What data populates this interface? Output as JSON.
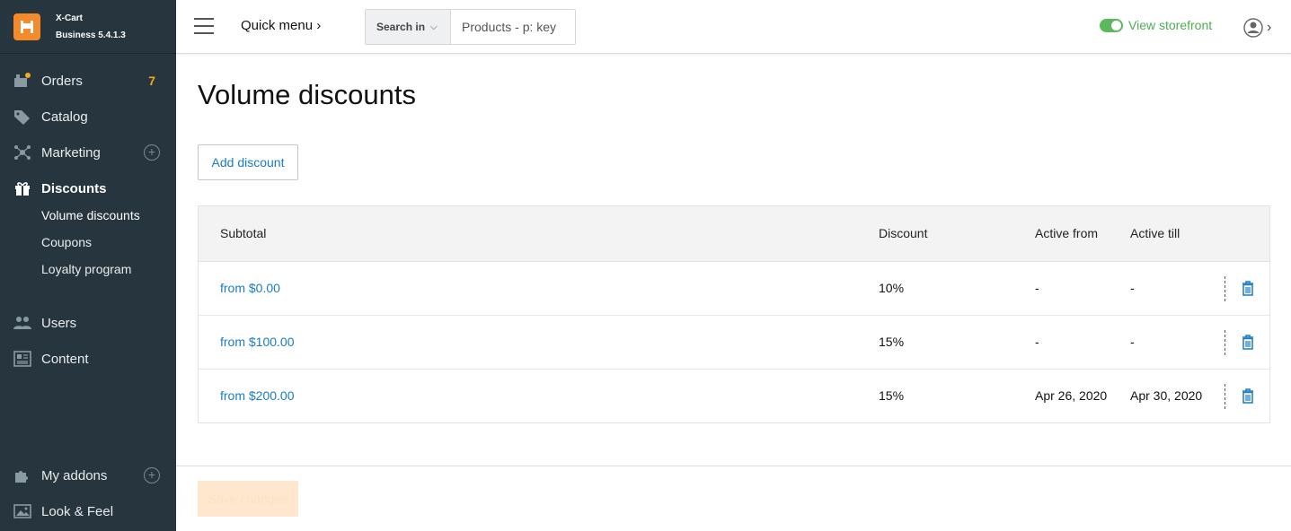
{
  "brand": {
    "name": "X-Cart",
    "edition": "Business 5.4.1.3",
    "accent": "#f48a2a"
  },
  "sidebar": {
    "items": [
      {
        "label": "Orders",
        "badge": "7",
        "icon": "orders-icon"
      },
      {
        "label": "Catalog",
        "icon": "tag-icon"
      },
      {
        "label": "Marketing",
        "icon": "marketing-icon"
      },
      {
        "label": "Discounts",
        "icon": "gift-icon"
      },
      {
        "label": "Users",
        "icon": "users-icon"
      },
      {
        "label": "Content",
        "icon": "content-icon"
      },
      {
        "label": "My addons",
        "icon": "puzzle-icon"
      },
      {
        "label": "Look & Feel",
        "icon": "image-icon"
      }
    ],
    "discounts_sub": [
      "Volume discounts",
      "Coupons",
      "Loyalty program"
    ]
  },
  "header": {
    "quick_menu": "Quick menu",
    "search_in_label": "Search in",
    "search_placeholder": "Products - p: key",
    "storefront_label": "View storefront",
    "storefront_color": "#4caf50"
  },
  "main": {
    "title": "Volume discounts",
    "add_button": "Add discount",
    "save_button": "Save changes",
    "columns": [
      "Subtotal",
      "Discount",
      "Active from",
      "Active till"
    ],
    "rows": [
      {
        "subtotal": "from $0.00",
        "discount": "10%",
        "active_from": "-",
        "active_till": "-"
      },
      {
        "subtotal": "from $100.00",
        "discount": "15%",
        "active_from": "-",
        "active_till": "-"
      },
      {
        "subtotal": "from $200.00",
        "discount": "15%",
        "active_from": "Apr 26, 2020",
        "active_till": "Apr 30, 2020"
      }
    ],
    "link_color": "#1a7cc1"
  }
}
